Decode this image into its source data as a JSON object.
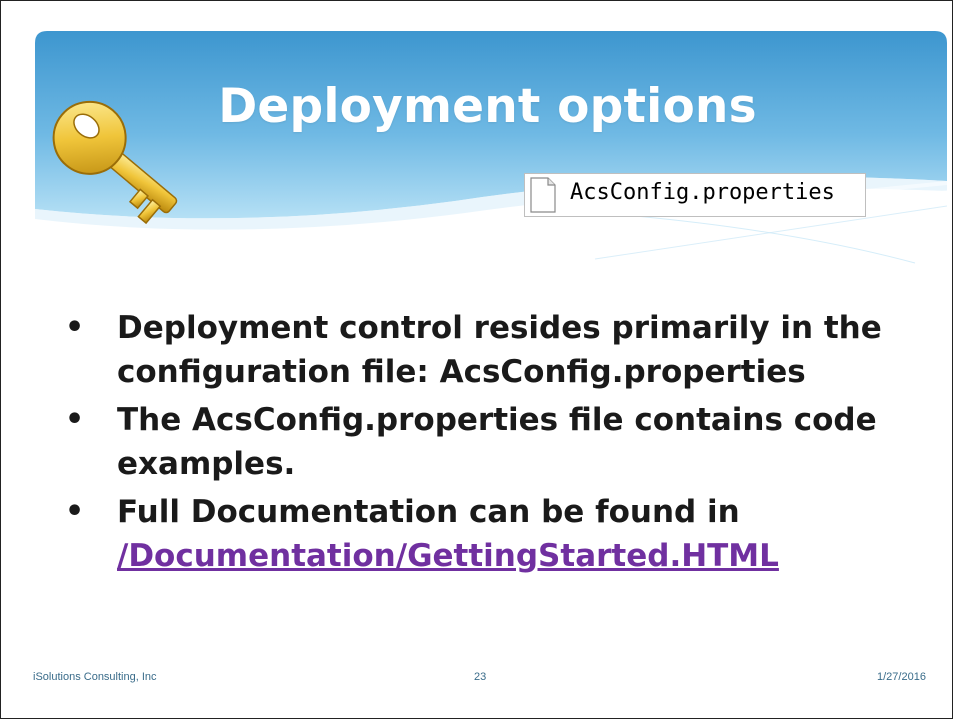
{
  "slide": {
    "title": "Deployment options",
    "file_label": "AcsConfig.properties",
    "bullets": [
      {
        "text": "Deployment control  resides primarily in the configuration file: AcsConfig.properties"
      },
      {
        "text": "The AcsConfig.properties  file contains code examples."
      },
      {
        "prefix": "Full Documentation can be found in ",
        "link": "/Documentation/GettingStarted.HTML"
      }
    ]
  },
  "footer": {
    "company": "iSolutions Consulting, Inc",
    "page_number": "23",
    "date": "1/27/2016"
  },
  "colors": {
    "banner_dark": "#3d96cf",
    "banner_light": "#a9daf2",
    "link": "#7030a0",
    "footer_text": "#3a6c8a"
  },
  "icons": {
    "key": "key-icon",
    "file": "document-icon"
  }
}
